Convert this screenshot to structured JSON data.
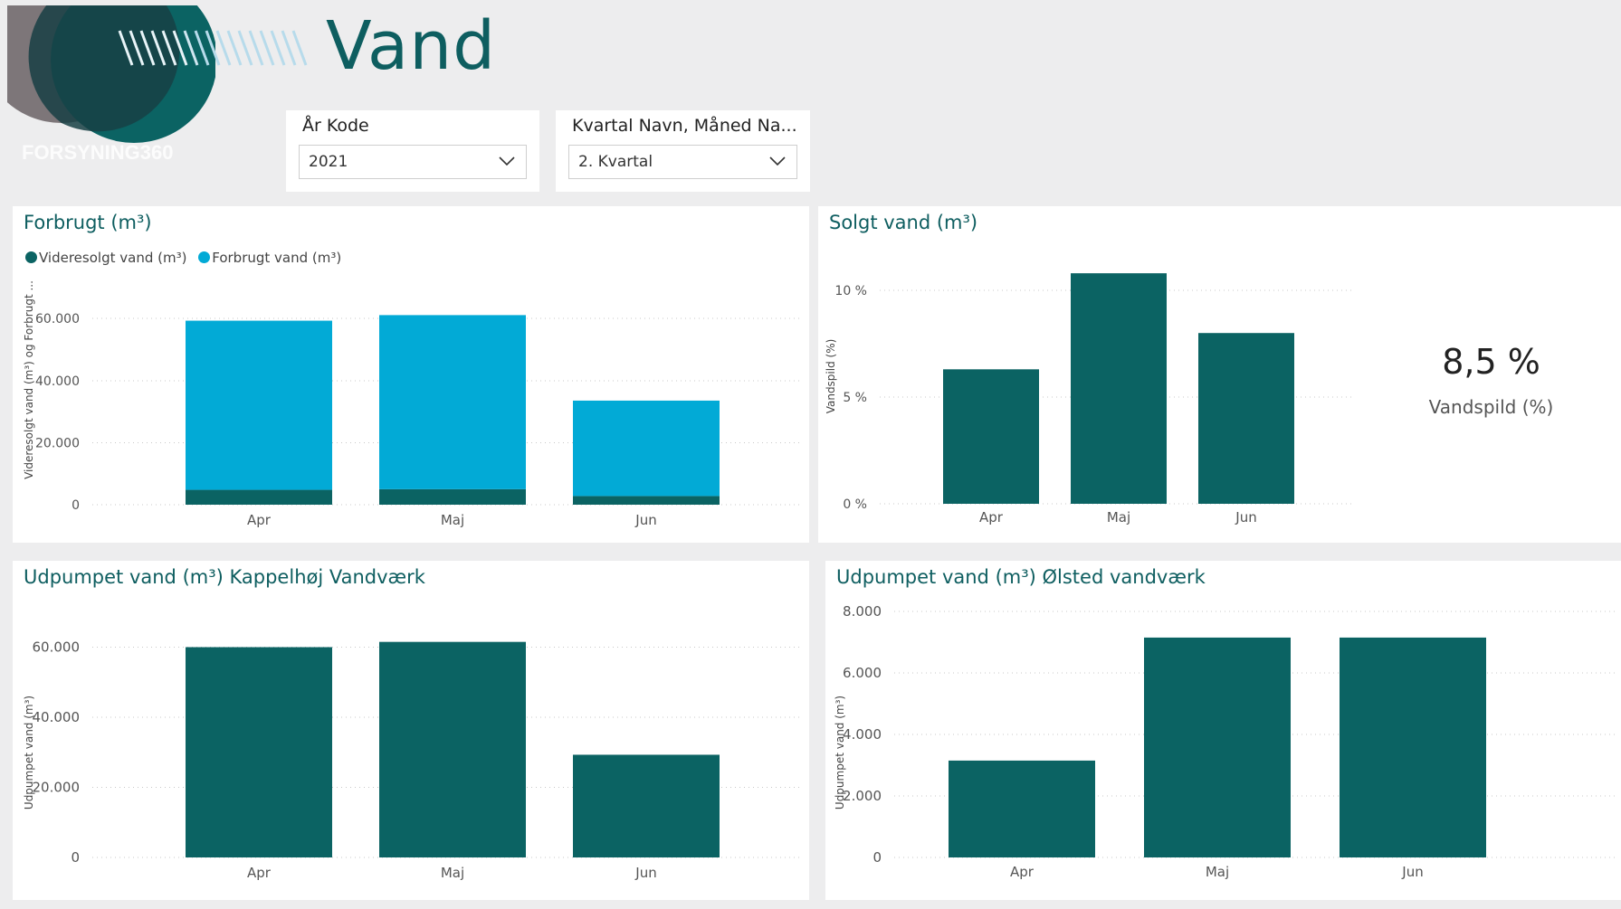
{
  "header": {
    "title": "Vand",
    "logo_text": "FORSYNING360"
  },
  "slicers": [
    {
      "label": "År Kode",
      "value": "2021"
    },
    {
      "label": "Kvartal Navn, Måned Na...",
      "value": "2. Kvartal"
    }
  ],
  "colors": {
    "dark_teal": "#0b6363",
    "light_blue": "#02aad6",
    "title_teal": "#0e5e60"
  },
  "kpi": {
    "value": "8,5 %",
    "label": "Vandspild (%)"
  },
  "chart_data": [
    {
      "type": "bar",
      "stacked": true,
      "title": "Forbrugt (m³)",
      "categories": [
        "Apr",
        "Maj",
        "Jun"
      ],
      "ylabel": "Videresolgt vand (m³) og Forbrugt ...",
      "yticks": [
        "0",
        "20.000",
        "40.000",
        "60.000"
      ],
      "ylim": [
        0,
        65000
      ],
      "series": [
        {
          "name": "Videresolgt vand (m³)",
          "values": [
            4800,
            5000,
            2800
          ]
        },
        {
          "name": "Forbrugt vand (m³)",
          "values": [
            54600,
            56200,
            30800
          ]
        }
      ]
    },
    {
      "type": "bar",
      "title": "Solgt vand (m³)",
      "categories": [
        "Apr",
        "Maj",
        "Jun"
      ],
      "ylabel": "Vandspild (%)",
      "yticks": [
        "0 %",
        "5 %",
        "10 %"
      ],
      "ylim": [
        0,
        0.12
      ],
      "values": [
        0.063,
        0.108,
        0.08
      ]
    },
    {
      "type": "bar",
      "title": "Udpumpet vand (m³) Kappelhøj Vandværk",
      "categories": [
        "Apr",
        "Maj",
        "Jun"
      ],
      "ylabel": "Udpumpet vand (m³)",
      "yticks": [
        "0",
        "20.000",
        "40.000",
        "60.000"
      ],
      "ylim": [
        0,
        65000
      ],
      "values": [
        60000,
        61500,
        29300
      ]
    },
    {
      "type": "bar",
      "title": "Udpumpet vand (m³) Ølsted vandværk",
      "categories": [
        "Apr",
        "Maj",
        "Jun"
      ],
      "ylabel": "Udpumpet vand (m³)",
      "yticks": [
        "0",
        "2.000",
        "4.000",
        "6.000",
        "8.000"
      ],
      "ylim": [
        0,
        8000
      ],
      "values": [
        3150,
        7150,
        7150
      ]
    }
  ]
}
